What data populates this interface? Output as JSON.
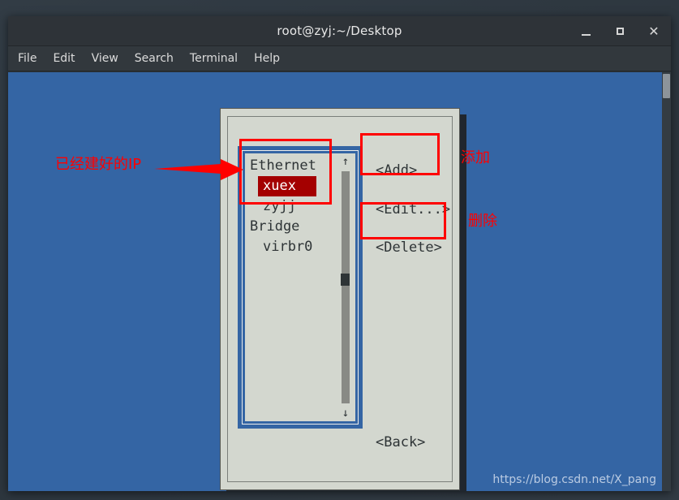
{
  "window": {
    "title": "root@zyj:~/Desktop",
    "controls": [
      {
        "name": "minimize",
        "glyph": "_"
      },
      {
        "name": "maximize",
        "glyph": "□"
      },
      {
        "name": "close",
        "glyph": "✕"
      }
    ]
  },
  "menubar": {
    "items": [
      "File",
      "Edit",
      "View",
      "Search",
      "Terminal",
      "Help"
    ]
  },
  "dialog": {
    "list": {
      "rows": [
        {
          "label": "Ethernet",
          "type": "group",
          "selected": false
        },
        {
          "label": "xuex",
          "type": "child",
          "selected": true
        },
        {
          "label": "zyjj",
          "type": "child",
          "selected": false
        },
        {
          "label": "Bridge",
          "type": "group",
          "selected": false
        },
        {
          "label": "virbr0",
          "type": "child",
          "selected": false
        }
      ],
      "scroll_up_glyph": "↑",
      "scroll_down_glyph": "↓"
    },
    "buttons": {
      "add": "<Add>",
      "edit": "<Edit...>",
      "delete": "<Delete>",
      "back": "<Back>"
    }
  },
  "annotations": {
    "ip_label": "已经建好的IP",
    "add_label": "添加",
    "delete_label": "删除"
  },
  "watermark": "https://blog.csdn.net/X_pang",
  "colors": {
    "terminal_blue": "#3465a4",
    "dialog_bg": "#d3d7cf",
    "selected_red": "#a40000",
    "annotation_red": "#ff0000",
    "titlebar": "#2e3338"
  }
}
